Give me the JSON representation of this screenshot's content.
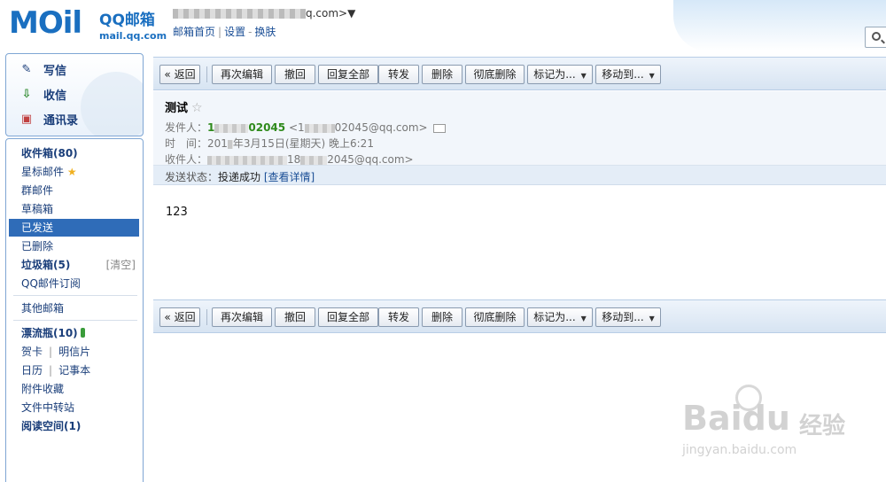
{
  "header": {
    "logo": "MOil",
    "brand_name": "QQ邮箱",
    "brand_domain": "mail.qq.com",
    "account_suffix": "q.com>▼",
    "links": [
      "邮箱首页",
      "设置",
      "换肤"
    ]
  },
  "quick_actions": [
    {
      "label": "写信",
      "icon": "pencil-icon"
    },
    {
      "label": "收信",
      "icon": "inbox-download-icon"
    },
    {
      "label": "通讯录",
      "icon": "contacts-icon"
    }
  ],
  "folders": {
    "inbox": "收件箱(80)",
    "starred": "星标邮件",
    "group": "群邮件",
    "drafts": "草稿箱",
    "sent": "已发送",
    "deleted": "已删除",
    "spam": "垃圾箱(5)",
    "spam_clear": "[清空]",
    "subscription": "QQ邮件订阅",
    "other": "其他邮箱",
    "bottle": "漂流瓶(10)",
    "card": "贺卡",
    "postcard": "明信片",
    "calendar": "日历",
    "notes": "记事本",
    "attachments": "附件收藏",
    "transfer": "文件中转站",
    "reading": "阅读空间(1)"
  },
  "toolbar": {
    "back": "« 返回",
    "reedit": "再次编辑",
    "recall": "撤回",
    "reply_all": "回复全部",
    "forward": "转发",
    "delete": "删除",
    "delete_forever": "彻底删除",
    "mark_as": "标记为...",
    "move_to": "移动到..."
  },
  "mail": {
    "subject": "测试",
    "star": "☆",
    "from_label": "发件人：",
    "from_name_prefix": "1",
    "from_name_suffix": "02045",
    "from_addr_prefix": "<1",
    "from_addr_suffix": "02045@qq.com>",
    "time_label": "时　间：",
    "time_prefix": "201",
    "time_suffix": "年3月15日(星期天) 晚上6:21",
    "to_label": "收件人：",
    "to_middle": "18",
    "to_suffix": "2045@qq.com>",
    "status_label": "发送状态：",
    "status_value": "投递成功",
    "status_link": "[查看详情]",
    "body": "123"
  },
  "watermark": {
    "brand": "Baidu",
    "cn": "经验",
    "url": "jingyan.baidu.com"
  },
  "colors": {
    "accent": "#2f6cb8",
    "sender_green": "#2f8a1c",
    "toolbar_bg": "#d7e4f2"
  }
}
